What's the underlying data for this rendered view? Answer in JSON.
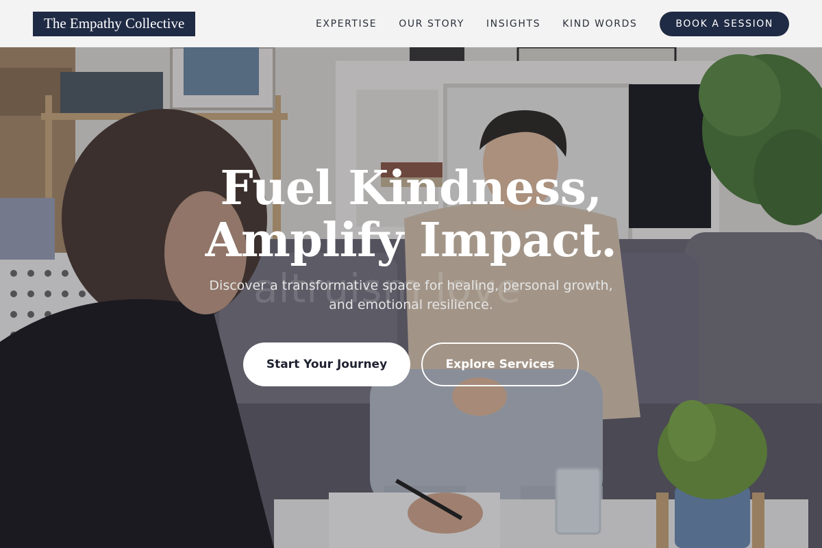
{
  "brand": {
    "name": "The Empathy Collective"
  },
  "nav": {
    "items": [
      {
        "label": "EXPERTISE"
      },
      {
        "label": "OUR STORY"
      },
      {
        "label": "INSIGHTS"
      },
      {
        "label": "KIND WORDS"
      }
    ],
    "cta_label": "BOOK A SESSION"
  },
  "hero": {
    "headline": "Fuel Kindness, Amplify Impact.",
    "watermark": "altruism love",
    "subtext": "Discover a transformative space for healing, personal growth, and emotional resilience.",
    "primary_cta": "Start Your Journey",
    "secondary_cta": "Explore Services"
  },
  "colors": {
    "brand_navy": "#1f2a44",
    "header_bg": "#f3f3f3",
    "button_light": "#ffffff"
  }
}
